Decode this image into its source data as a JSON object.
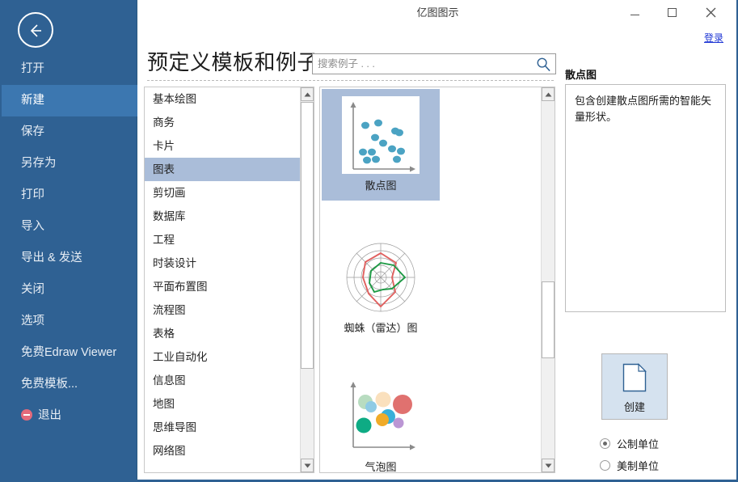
{
  "window": {
    "title": "亿图图示",
    "minimize_label": "−",
    "maximize_label": "□",
    "close_label": "✕",
    "login_label": "登录"
  },
  "sidebar": {
    "back_icon": "back-arrow-icon",
    "items": [
      {
        "label": "打开",
        "selected": false
      },
      {
        "label": "新建",
        "selected": true
      },
      {
        "label": "保存",
        "selected": false
      },
      {
        "label": "另存为",
        "selected": false
      },
      {
        "label": "打印",
        "selected": false
      },
      {
        "label": "导入",
        "selected": false
      },
      {
        "label": "导出 & 发送",
        "selected": false
      },
      {
        "label": "关闭",
        "selected": false
      },
      {
        "label": "选项",
        "selected": false
      },
      {
        "label": "免费Edraw Viewer",
        "selected": false
      },
      {
        "label": "免费模板...",
        "selected": false
      },
      {
        "label": "退出",
        "selected": false,
        "icon": "exit-icon"
      }
    ]
  },
  "header": {
    "title": "预定义模板和例子",
    "search_placeholder": "搜索例子 . . .",
    "search_value": "",
    "search_icon": "search-icon"
  },
  "categories": {
    "items": [
      {
        "label": "基本绘图",
        "selected": false
      },
      {
        "label": "商务",
        "selected": false
      },
      {
        "label": "卡片",
        "selected": false
      },
      {
        "label": "图表",
        "selected": true
      },
      {
        "label": "剪切画",
        "selected": false
      },
      {
        "label": "数据库",
        "selected": false
      },
      {
        "label": "工程",
        "selected": false
      },
      {
        "label": "时装设计",
        "selected": false
      },
      {
        "label": "平面布置图",
        "selected": false
      },
      {
        "label": "流程图",
        "selected": false
      },
      {
        "label": "表格",
        "selected": false
      },
      {
        "label": "工业自动化",
        "selected": false
      },
      {
        "label": "信息图",
        "selected": false
      },
      {
        "label": "地图",
        "selected": false
      },
      {
        "label": "思维导图",
        "selected": false
      },
      {
        "label": "网络图",
        "selected": false
      }
    ],
    "scroll_up_icon": "caret-up-icon",
    "scroll_down_icon": "caret-down-icon"
  },
  "templates": {
    "items": [
      {
        "label": "散点图",
        "thumb": "scatter-plot-thumb",
        "selected": true
      },
      {
        "label": "蜘蛛（雷达）图",
        "thumb": "radar-chart-thumb",
        "selected": false
      },
      {
        "label": "气泡图",
        "thumb": "bubble-chart-thumb",
        "selected": false
      }
    ],
    "scroll_up_icon": "caret-up-icon",
    "scroll_down_icon": "caret-down-icon"
  },
  "info": {
    "title": "散点图",
    "description": "包含创建散点图所需的智能矢量形状。"
  },
  "actions": {
    "create_label": "创建",
    "create_icon": "new-document-icon",
    "units": [
      {
        "label": "公制单位",
        "selected": true
      },
      {
        "label": "美制单位",
        "selected": false
      }
    ]
  },
  "colors": {
    "sidebar_bg": "#2f6193",
    "sidebar_selected": "#3c77b0",
    "list_selected": "#aabdd9",
    "create_bg": "#d5e2ef",
    "link": "#1d35d4",
    "scatter_dot": "#4ba3c3"
  }
}
